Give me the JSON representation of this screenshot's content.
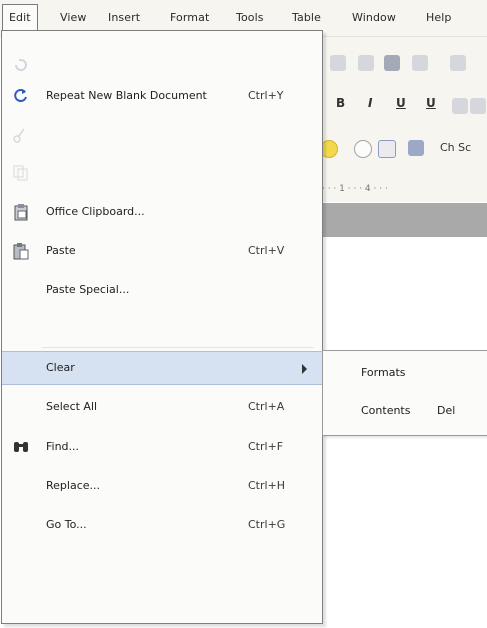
{
  "menubar": {
    "items": [
      "Edit",
      "View",
      "Insert",
      "Format",
      "Tools",
      "Table",
      "Window",
      "Help"
    ]
  },
  "toolbar": {
    "format_letters": [
      "B",
      "I",
      "U",
      "U"
    ],
    "ch_label": "Ch Sc",
    "ruler_text": "· · · 1 · · · 4 · · ·"
  },
  "edit_menu": {
    "items": [
      {
        "label": "",
        "shortcut": "",
        "enabled": false,
        "icon": "undo-icon"
      },
      {
        "label": "Repeat New Blank Document",
        "shortcut": "Ctrl+Y",
        "enabled": true,
        "icon": "repeat-icon"
      },
      {
        "label": "",
        "shortcut": "",
        "enabled": false,
        "icon": "cut-icon"
      },
      {
        "label": "",
        "shortcut": "",
        "enabled": false,
        "icon": "copy-icon"
      },
      {
        "label": "Office Clipboard...",
        "shortcut": "",
        "enabled": true,
        "icon": "clipboard-icon"
      },
      {
        "label": "Paste",
        "shortcut": "Ctrl+V",
        "enabled": true,
        "icon": "paste-icon"
      },
      {
        "label": "Paste Special...",
        "shortcut": "",
        "enabled": true,
        "icon": ""
      },
      {
        "label": "",
        "shortcut": "",
        "enabled": false,
        "icon": ""
      },
      {
        "label": "Clear",
        "shortcut": "",
        "enabled": true,
        "icon": "",
        "submenu": true
      },
      {
        "label": "Select All",
        "shortcut": "Ctrl+A",
        "enabled": true,
        "icon": ""
      },
      {
        "label": "Find...",
        "shortcut": "Ctrl+F",
        "enabled": true,
        "icon": "binoculars-icon"
      },
      {
        "label": "Replace...",
        "shortcut": "Ctrl+H",
        "enabled": true,
        "icon": ""
      },
      {
        "label": "Go To...",
        "shortcut": "Ctrl+G",
        "enabled": true,
        "icon": ""
      },
      {
        "label": "",
        "shortcut": "",
        "enabled": false,
        "icon": ""
      },
      {
        "label": "",
        "shortcut": "",
        "enabled": false,
        "icon": ""
      }
    ]
  },
  "clear_submenu": {
    "items": [
      {
        "label": "Formats",
        "shortcut": ""
      },
      {
        "label": "Contents",
        "shortcut": "Del"
      }
    ]
  }
}
